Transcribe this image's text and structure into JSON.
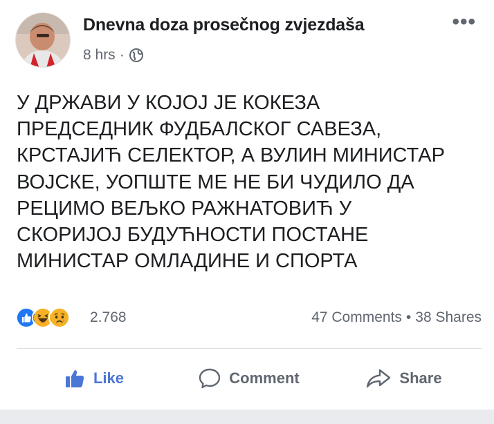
{
  "post": {
    "page_name": "Dnevna doza prosečnog zvjezdaša",
    "time": "8 hrs",
    "separator": "·",
    "privacy_icon": "globe-icon",
    "more_label": "•••",
    "text": "У ДРЖАВИ У КОЈОЈ ЈЕ КОКЕЗА\nПРЕДСЕДНИК ФУДБАЛСКОГ САВЕЗА,\nКРСТАЈИЋ СЕЛЕКТОР, А ВУЛИН МИНИСТАР\nВОЈСКЕ, УОПШТЕ МЕ НЕ БИ ЧУДИЛО ДА\nРЕЦИМО ВЕЉКО РАЖНАТОВИЋ У\nСКОРИЈОЈ БУДУЋНОСТИ ПОСТАНЕ\nМИНИСТАР ОМЛАДИНЕ И СПОРТА"
  },
  "stats": {
    "reaction_icons": [
      "like-reaction-icon",
      "haha-reaction-icon",
      "sad-reaction-icon"
    ],
    "reaction_count": "2.768",
    "comments": "47 Comments",
    "separator": "•",
    "shares": "38 Shares"
  },
  "actions": {
    "like": "Like",
    "comment": "Comment",
    "share": "Share"
  },
  "colors": {
    "like_blue": "#4a76d6",
    "muted": "#606770",
    "text": "#1c1e21",
    "reaction_blue": "#2078f4",
    "reaction_yellow": "#f7b125"
  }
}
